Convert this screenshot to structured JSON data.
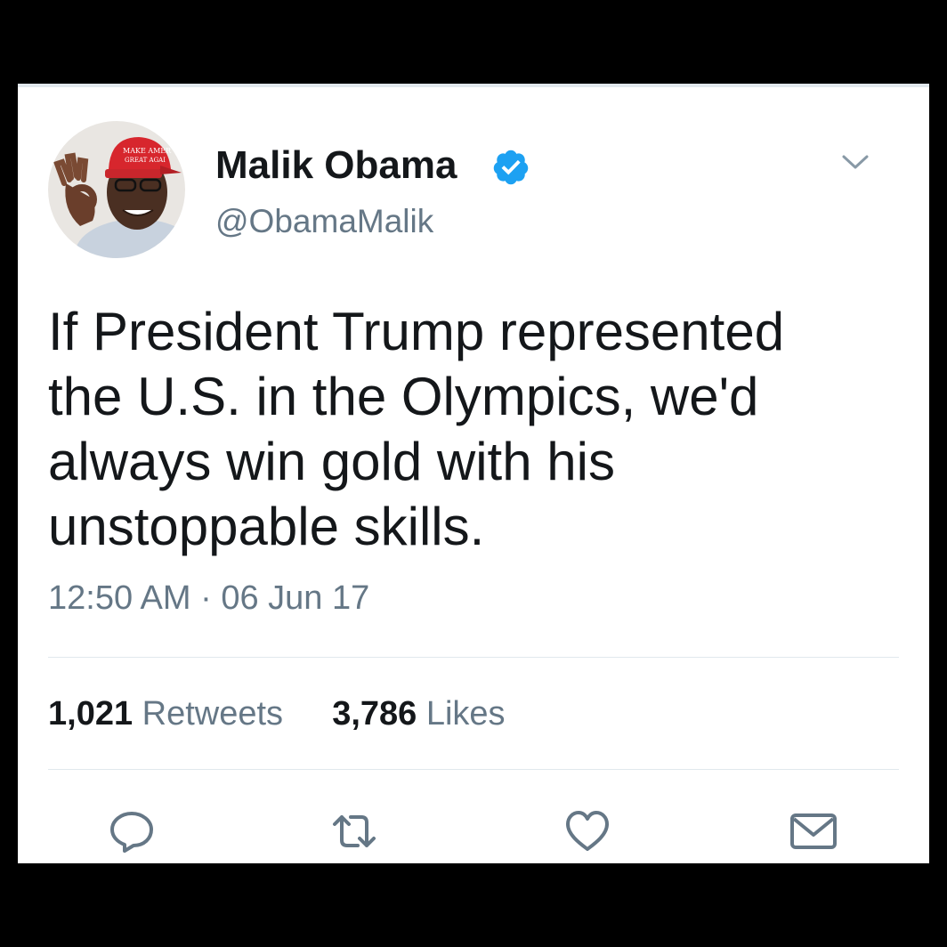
{
  "tweet": {
    "display_name": "Malik Obama",
    "handle": "@ObamaMalik",
    "text": "If President Trump represented the U.S. in the Olympics, we'd always win gold with his unstoppable skills.",
    "timestamp": "12:50 AM · 06 Jun 17",
    "avatar_hat_text_line1": "MAKE AMER",
    "avatar_hat_text_line2": "GREAT AGAI"
  },
  "stats": {
    "retweets_count": "1,021",
    "retweets_label": "Retweets",
    "likes_count": "3,786",
    "likes_label": "Likes"
  },
  "icons": {
    "verified": "verified-badge-icon",
    "caret": "chevron-down-icon",
    "reply": "reply-icon",
    "retweet": "retweet-icon",
    "like": "heart-icon",
    "share": "envelope-icon"
  },
  "colors": {
    "verified_blue": "#1da1f2",
    "text_primary": "#14171a",
    "text_secondary": "#657786",
    "divider": "#e1e8ed",
    "icon_gray": "#657786"
  }
}
